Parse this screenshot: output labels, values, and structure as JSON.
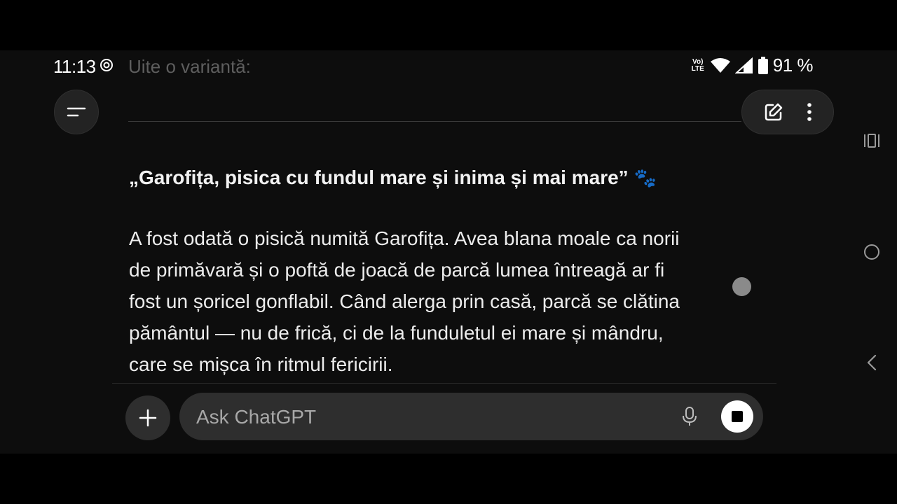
{
  "status_bar": {
    "time": "11:13",
    "network_label": "Vo) LTE",
    "battery_percent": "91 %",
    "icons": [
      "dnd-icon",
      "volte-icon",
      "wifi-icon",
      "signal-icon",
      "battery-icon"
    ]
  },
  "faded_line": "Uite o variantă:",
  "header": {
    "menu_icon": "menu-icon",
    "new_chat_icon": "edit-icon",
    "more_icon": "more-vertical-icon"
  },
  "content": {
    "title": "„Garofița, pisica cu fundul mare și inima și mai mare”",
    "title_emoji": "🐾",
    "paragraph_lines": [
      "A fost odată o pisică numită Garofița. Avea blana moale ca norii",
      "de primăvară și o poftă de joacă de parcă lumea întreagă ar fi",
      "fost un șoricel gonflabil. Când alerga prin casă, parcă se clătina",
      "pământul — nu de frică, ci de la funduletul ei mare și mândru,",
      "care se mișca în ritmul fericirii."
    ]
  },
  "composer": {
    "placeholder": "Ask ChatGPT",
    "attach_icon": "plus-icon",
    "mic_icon": "mic-icon",
    "stop_icon": "stop-icon"
  },
  "system_nav": [
    "recents-icon",
    "home-icon",
    "back-icon"
  ],
  "colors": {
    "background": "#0d0d0d",
    "surface": "#2e2e2e",
    "text": "#ececec",
    "muted": "#a8a8a8"
  }
}
